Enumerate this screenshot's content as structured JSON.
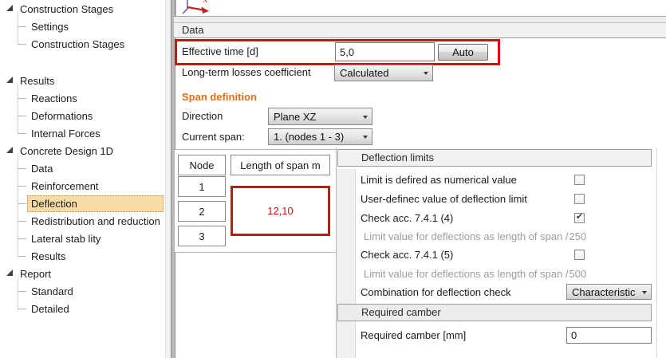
{
  "colors": {
    "annotation_red": "#cf1111",
    "accent_orange": "#e0701a",
    "selection_tan": "#f8dba6"
  },
  "sidebar": {
    "selected_item": "Deflection",
    "sections": [
      {
        "label": "Construction Stages",
        "children": [
          "Settings",
          "Construction Stages"
        ]
      },
      {
        "label": "Results",
        "children": [
          "Reactions",
          "Deformations",
          "Internal Forces"
        ]
      },
      {
        "label": "Concrete Design 1D",
        "children": [
          "Data",
          "Reinforcement",
          "Deflection",
          "Redistribution and reduction",
          "Lateral stab lity",
          "Results"
        ]
      },
      {
        "label": "Report",
        "children": [
          "Standard",
          "Detailed"
        ]
      }
    ]
  },
  "data_section": {
    "header": "Data",
    "effective_time_label": "Effective time [d]",
    "effective_time_value": "5,0",
    "auto_button": "Auto",
    "long_term_label": "Long-term losses coefficient",
    "long_term_value": "Calculated"
  },
  "span_definition": {
    "title": "Span definition",
    "direction_label": "Direction",
    "direction_value": "Plane XZ",
    "current_span_label": "Current span:",
    "current_span_value": "1. (nodes 1 - 3)",
    "table": {
      "node_header": "Node",
      "length_header": "Length of span m",
      "nodes": [
        "1",
        "2",
        "3"
      ],
      "span_length": "12,10"
    }
  },
  "deflection_limits": {
    "header": "Deflection limits",
    "rows": [
      {
        "label": "Limit is defired as numerical value",
        "checked": false
      },
      {
        "label": "User-definec value of deflection limit",
        "checked": false
      },
      {
        "label": "Check acc. 7.4.1 (4)",
        "checked": true
      },
      {
        "label": "Limit value for deflections as length of span /",
        "value": "250"
      },
      {
        "label": "Check acc. 7.4.1 (5)",
        "checked": false
      },
      {
        "label": "Limit value for deflections as length of span /",
        "value": "500"
      },
      {
        "label": "Combination for deflection check",
        "value": "Characteristic"
      }
    ]
  },
  "required_camber": {
    "header": "Required camber",
    "label": "Required camber [mm]",
    "value": "0"
  }
}
